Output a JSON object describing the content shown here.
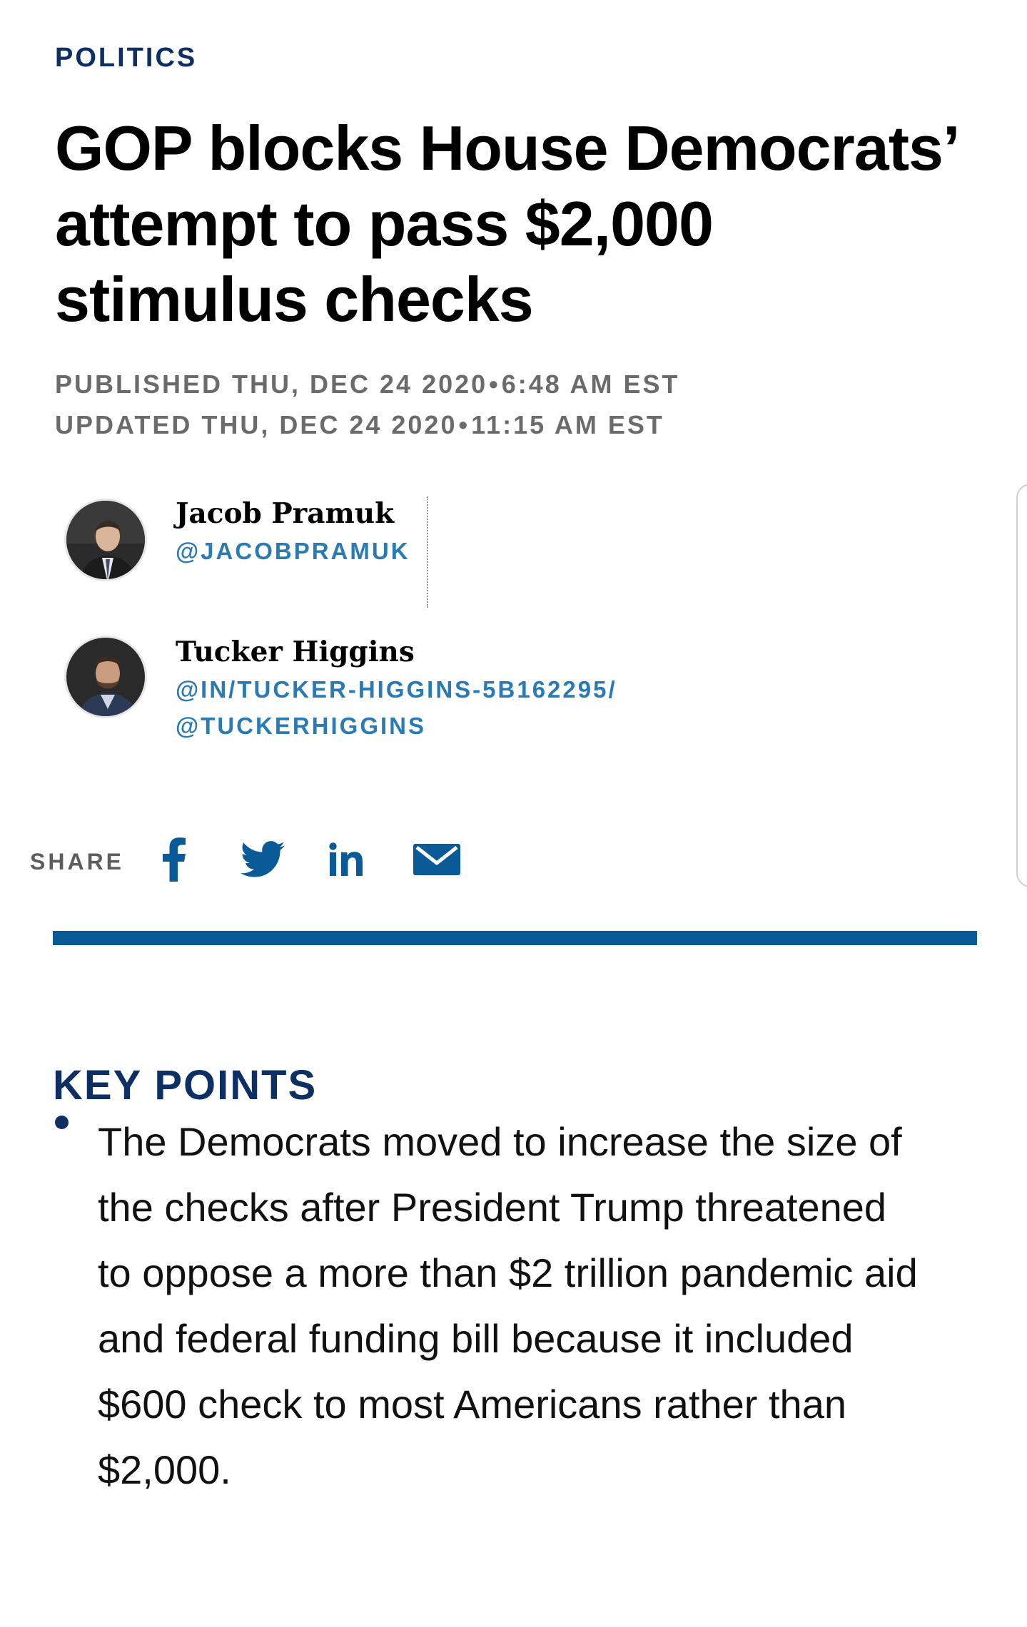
{
  "article": {
    "section": "POLITICS",
    "headline": "GOP blocks House Democrats’ attempt to pass $2,000 stimulus checks",
    "published": {
      "label": "PUBLISHED THU, DEC 24 2020",
      "separator": "•",
      "time": "6:48 AM EST"
    },
    "updated": {
      "label": "UPDATED THU, DEC 24 2020",
      "separator": "•",
      "time": "11:15 AM EST"
    }
  },
  "authors": [
    {
      "name": "Jacob Pramuk",
      "handles": [
        "@JACOBPRAMUK"
      ]
    },
    {
      "name": "Tucker Higgins",
      "handles": [
        "@IN/TUCKER-HIGGINS-5B162295/",
        "@TUCKERHIGGINS"
      ]
    }
  ],
  "share": {
    "label": "SHARE",
    "icons": [
      "facebook-icon",
      "twitter-icon",
      "linkedin-icon",
      "email-icon"
    ],
    "icon_color": "#0a5a97"
  },
  "key_points": {
    "title": "KEY POINTS",
    "items": [
      "The Democrats moved to increase the size of the checks after President Trump threatened to oppose a more than $2 trillion pandemic aid and federal funding bill because it included $600 check to most Americans rather than $2,000."
    ]
  },
  "colors": {
    "brand_navy": "#0e2f63",
    "accent_blue": "#0a5a97",
    "link_blue": "#2a7ab3",
    "meta_gray": "#6b6b6b"
  }
}
